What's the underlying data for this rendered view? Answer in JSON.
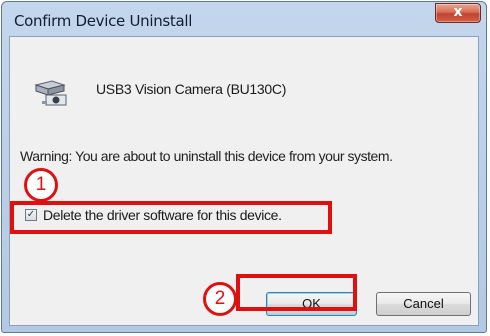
{
  "dialog": {
    "title": "Confirm Device Uninstall",
    "close_label": "x",
    "device_name": "USB3 Vision Camera (BU130C)",
    "warning": "Warning: You are about to uninstall this device from your system.",
    "checkbox": {
      "label": "Delete the driver software for this device.",
      "checked": true,
      "mark": "✓"
    },
    "buttons": {
      "ok": "OK",
      "cancel": "Cancel"
    }
  },
  "annotations": {
    "marker_1": "1",
    "marker_2": "2",
    "color": "#e01010"
  }
}
